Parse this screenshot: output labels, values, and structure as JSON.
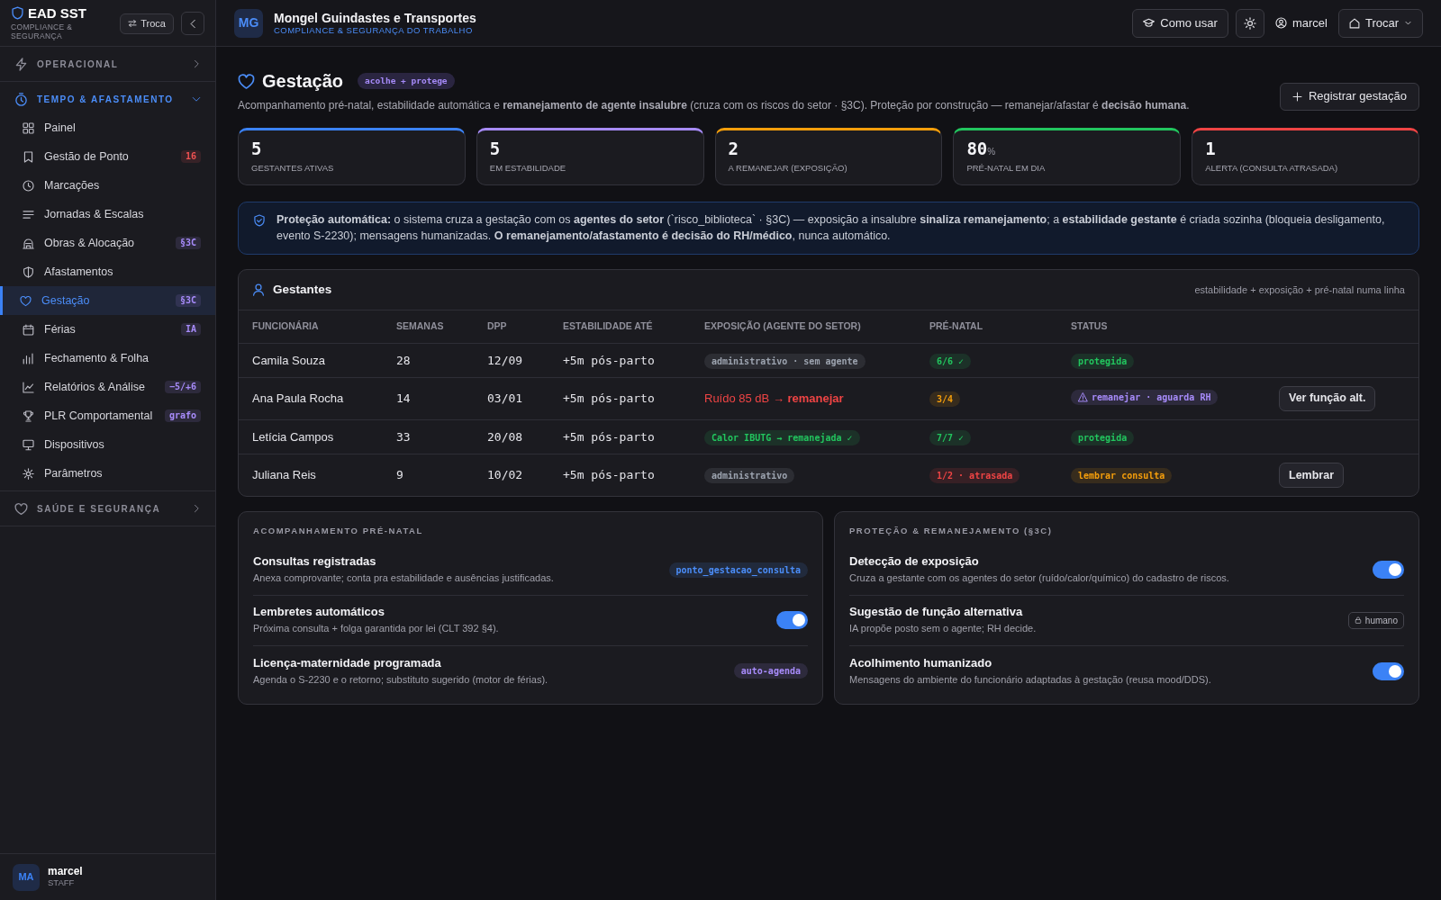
{
  "sidebar": {
    "brand": {
      "title": "EAD SST",
      "subtitle": "COMPLIANCE & SEGURANÇA"
    },
    "switch_button": "Troca",
    "sections": [
      {
        "label": "OPERACIONAL",
        "expanded": false
      },
      {
        "label": "TEMPO & AFASTAMENTO",
        "expanded": true,
        "items": [
          {
            "label": "Painel",
            "selected": false
          },
          {
            "label": "Gestão de Ponto",
            "selected": false,
            "badge": {
              "text": "16",
              "color": "#f05252"
            }
          },
          {
            "label": "Marcações",
            "selected": false
          },
          {
            "label": "Jornadas & Escalas",
            "selected": false
          },
          {
            "label": "Obras & Alocação",
            "selected": false,
            "badge": {
              "text": "§3C",
              "color": "#a78bfa"
            }
          },
          {
            "label": "Afastamentos",
            "selected": false
          },
          {
            "label": "Gestação",
            "selected": true,
            "badge": {
              "text": "§3C",
              "color": "#a78bfa"
            }
          },
          {
            "label": "Férias",
            "selected": false,
            "badge": {
              "text": "IA",
              "color": "#a78bfa"
            }
          },
          {
            "label": "Fechamento & Folha",
            "selected": false
          },
          {
            "label": "Relatórios & Análise",
            "selected": false,
            "badge": {
              "text": "−5/+6",
              "color": "#a78bfa"
            }
          },
          {
            "label": "PLR Comportamental",
            "selected": false,
            "badge": {
              "text": "grafo",
              "color": "#a78bfa"
            }
          },
          {
            "label": "Dispositivos",
            "selected": false
          },
          {
            "label": "Parâmetros",
            "selected": false
          }
        ]
      },
      {
        "label": "SAÚDE E SEGURANÇA",
        "expanded": false
      }
    ],
    "user": {
      "initials": "MA",
      "name": "marcel",
      "role": "STAFF"
    }
  },
  "header": {
    "company": {
      "initials": "MG",
      "name": "Mongel Guindastes e Transportes",
      "subtitle": "COMPLIANCE & SEGURANÇA DO TRABALHO"
    },
    "help_button": "Como usar",
    "user": "marcel",
    "switch_button": "Trocar"
  },
  "page": {
    "title": "Gestação",
    "tag": "acolhe + protege",
    "description": "Acompanhamento pré-natal, estabilidade automática e **remanejamento de agente insalubre** (cruza com os riscos do setor · §3C). Proteção por construção — remanejar/afastar é **decisão humana**.",
    "action_button": "Registrar gestação"
  },
  "stats": [
    {
      "value": "5",
      "label": "GESTANTES ATIVAS",
      "color": "#3b82f6"
    },
    {
      "value": "5",
      "label": "EM ESTABILIDADE",
      "color": "#a78bfa"
    },
    {
      "value": "2",
      "label": "A REMANEJAR (EXPOSIÇÃO)",
      "color": "#f59e0b"
    },
    {
      "value": "80",
      "unit": "%",
      "label": "PRÉ-NATAL EM DIA",
      "color": "#22c55e"
    },
    {
      "value": "1",
      "label": "ALERTA (CONSULTA ATRASADA)",
      "color": "#ef4444"
    }
  ],
  "alert": {
    "text": "**Proteção automática:** o sistema cruza a gestação com os **agentes do setor** (`risco_biblioteca` · §3C) — exposição a insalubre **sinaliza remanejamento**; a **estabilidade gestante** é criada sozinha (bloqueia desligamento, evento S-2230); mensagens humanizadas. **O remanejamento/afastamento é decisão do RH/médico**, nunca automático."
  },
  "table": {
    "title": "Gestantes",
    "note": "estabilidade + exposição + pré-natal numa linha",
    "columns": [
      "FUNCIONÁRIA",
      "SEMANAS",
      "DPP",
      "ESTABILIDADE ATÉ",
      "EXPOSIÇÃO (AGENTE DO SETOR)",
      "PRÉ-NATAL",
      "STATUS"
    ],
    "rows": [
      {
        "name": "Camila Souza",
        "weeks": "28",
        "due_date": "12/09",
        "stability": "+5m pós-parto",
        "exposure": {
          "kind": "tag",
          "text": "administrativo · sem agente",
          "color": "#9ca3af"
        },
        "prenatal": {
          "text": "6/6 ✓",
          "color": "#22c55e"
        },
        "status": {
          "text": "protegida",
          "color": "#22c55e",
          "flagged": false
        }
      },
      {
        "name": "Ana Paula Rocha",
        "weeks": "14",
        "due_date": "03/01",
        "stability": "+5m pós-parto",
        "exposure": {
          "kind": "alert",
          "text": "Ruído 85 dB → **remanejar**",
          "color": "#ef4444"
        },
        "prenatal": {
          "text": "3/4",
          "color": "#f59e0b"
        },
        "status": {
          "text": "remanejar · aguarda RH",
          "color": "#a78bfa",
          "flagged": true
        },
        "action": "Ver função alt."
      },
      {
        "name": "Letícia Campos",
        "weeks": "33",
        "due_date": "20/08",
        "stability": "+5m pós-parto",
        "exposure": {
          "kind": "tag",
          "text": "Calor IBUTG → remanejada ✓",
          "color": "#22c55e"
        },
        "prenatal": {
          "text": "7/7 ✓",
          "color": "#22c55e"
        },
        "status": {
          "text": "protegida",
          "color": "#22c55e",
          "flagged": false
        }
      },
      {
        "name": "Juliana Reis",
        "weeks": "9",
        "due_date": "10/02",
        "stability": "+5m pós-parto",
        "exposure": {
          "kind": "tag",
          "text": "administrativo",
          "color": "#9ca3af"
        },
        "prenatal": {
          "text": "1/2 · atrasada",
          "color": "#ef4444"
        },
        "status": {
          "text": "lembrar consulta",
          "color": "#f59e0b",
          "flagged": false
        },
        "action": "Lembrar"
      }
    ]
  },
  "panels": [
    {
      "title": "ACOMPANHAMENTO PRÉ-NATAL",
      "rows": [
        {
          "title": "Consultas registradas",
          "description": "Anexa comprovante; conta pra estabilidade e ausências justificadas.",
          "kind": "code",
          "text": "ponto_gestacao_consulta",
          "color": "#4b8df8"
        },
        {
          "title": "Lembretes automáticos",
          "description": "Próxima consulta + folga garantida por lei (CLT 392 §4).",
          "kind": "toggle",
          "on": true
        },
        {
          "title": "Licença-maternidade programada",
          "description": "Agenda o S-2230 e o retorno; substituto sugerido (motor de férias).",
          "kind": "code",
          "text": "auto-agenda",
          "color": "#a78bfa"
        }
      ]
    },
    {
      "title": "PROTEÇÃO & REMANEJAMENTO (§3C)",
      "rows": [
        {
          "title": "Detecção de exposição",
          "description": "Cruza a gestante com os agentes do setor (ruído/calor/químico) do cadastro de riscos.",
          "kind": "toggle",
          "on": true
        },
        {
          "title": "Sugestão de função alternativa",
          "description": "IA propõe posto sem o agente; RH decide.",
          "kind": "locked",
          "text": "humano"
        },
        {
          "title": "Acolhimento humanizado",
          "description": "Mensagens do ambiente do funcionário adaptadas à gestação (reusa mood/DDS).",
          "kind": "toggle",
          "on": true
        }
      ]
    }
  ]
}
